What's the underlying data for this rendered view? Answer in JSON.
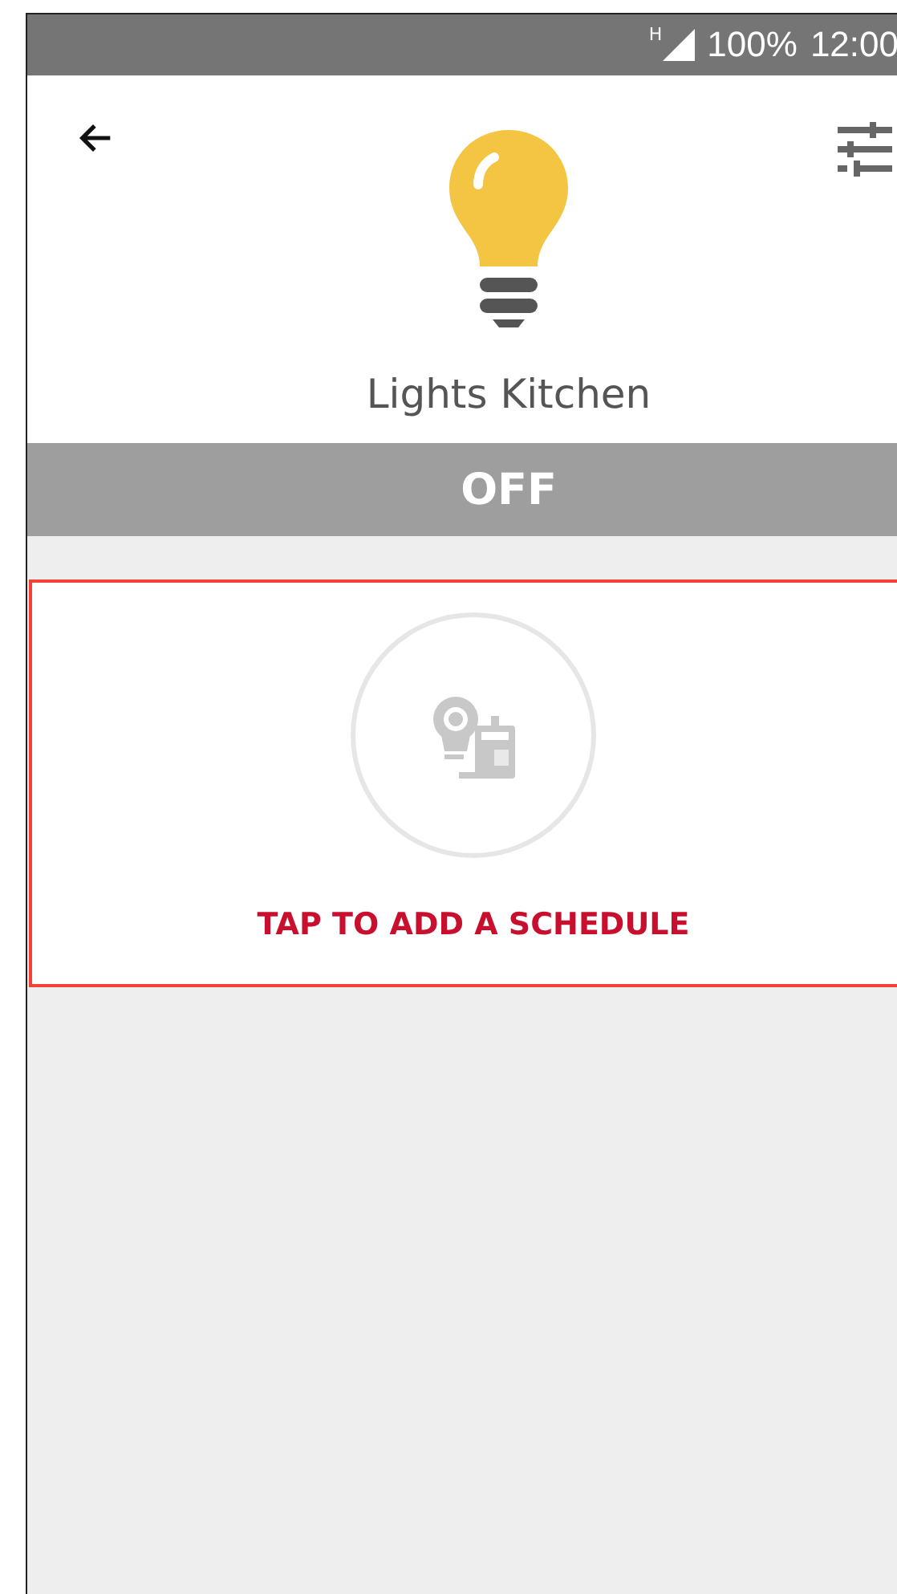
{
  "status_bar": {
    "network": "H",
    "battery": "100%",
    "time": "12:00"
  },
  "device": {
    "name": "Lights Kitchen",
    "on": false,
    "state": "OFF"
  },
  "schedule": {
    "label": "TAP TO ADD A SCHEDULE",
    "highlighted": true
  }
}
